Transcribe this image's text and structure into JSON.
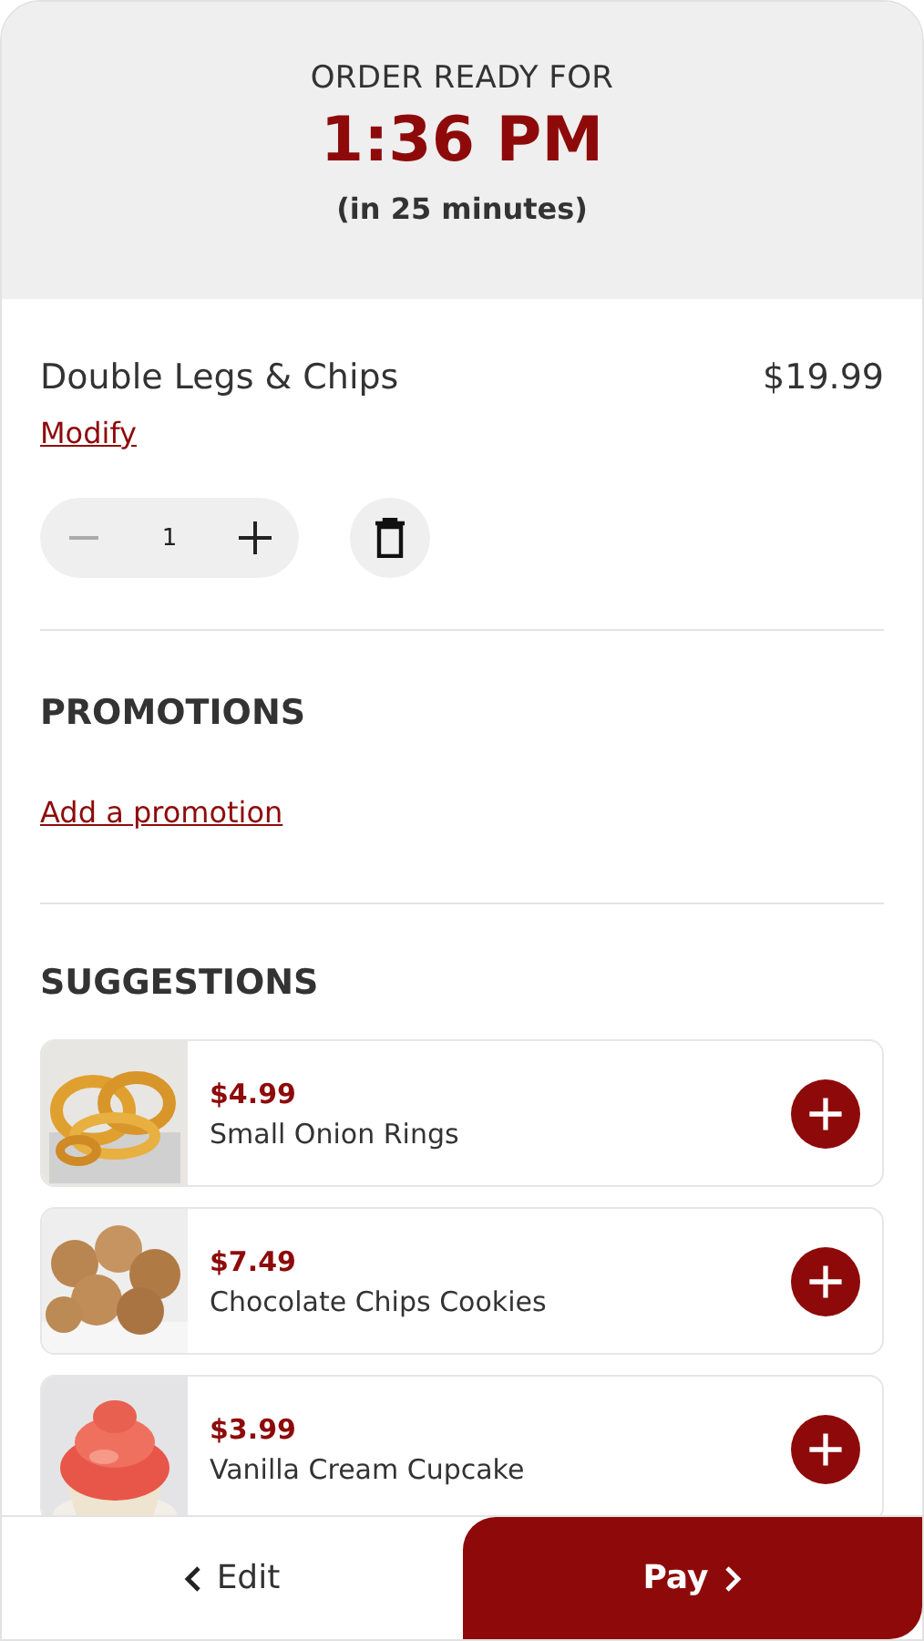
{
  "header": {
    "label": "ORDER READY FOR",
    "time": "1:36 PM",
    "eta": "(in 25 minutes)"
  },
  "cart_item": {
    "name": "Double Legs & Chips",
    "price": "$19.99",
    "modify_link": "Modify",
    "quantity": "1",
    "decrease_disabled": true
  },
  "promotions": {
    "title": "PROMOTIONS",
    "link": "Add a promotion"
  },
  "suggestions": {
    "title": "SUGGESTIONS",
    "items": [
      {
        "price": "$4.99",
        "name": "Small Onion Rings"
      },
      {
        "price": "$7.49",
        "name": "Chocolate Chips Cookies"
      },
      {
        "price": "$3.99",
        "name": "Vanilla Cream Cupcake"
      }
    ]
  },
  "footer": {
    "back_button": "Edit",
    "pay_button": "Pay"
  }
}
